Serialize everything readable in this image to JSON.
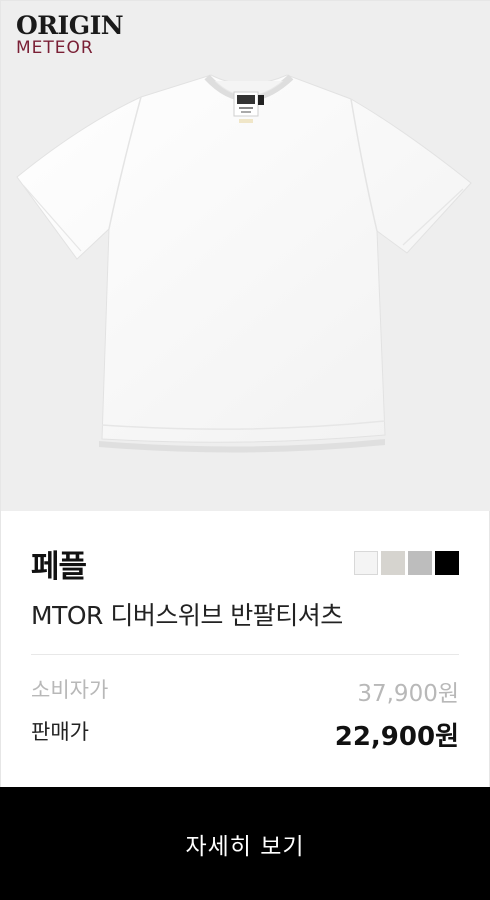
{
  "brand": {
    "line1": "ORIGIN",
    "line2": "METEOR"
  },
  "product": {
    "seller": "페플",
    "name": "MTOR 디버스위브 반팔티셔츠",
    "image_icon": "tshirt-white-icon",
    "swatches": [
      {
        "color": "#f4f4f4"
      },
      {
        "color": "#d6d4cf"
      },
      {
        "color": "#bdbdbd"
      },
      {
        "color": "#000000"
      }
    ]
  },
  "price": {
    "msrp_label": "소비자가",
    "msrp_value": "37,900원",
    "sale_label": "판매가",
    "sale_value": "22,900원"
  },
  "action": {
    "detail_label": "자세히 보기"
  }
}
